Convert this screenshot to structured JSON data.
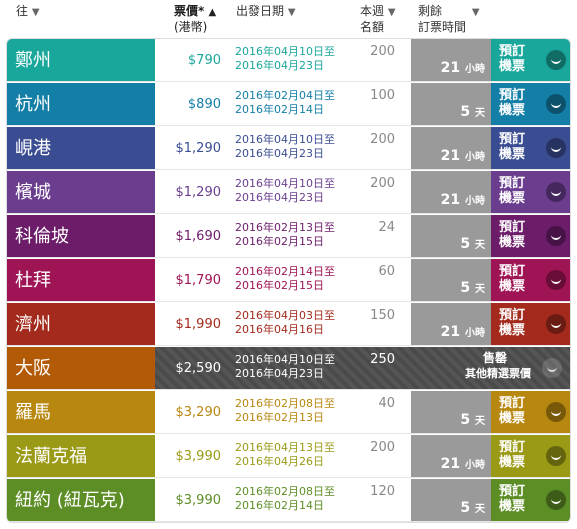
{
  "header": {
    "dest_label": "往",
    "price_label": "票價*",
    "price_sub": "(港幣)",
    "date_label": "出發日期",
    "quota_label": "本週",
    "quota_sub": "名額",
    "remaining_label": "剩餘",
    "remaining_sub": "訂票時間",
    "sort_down": "▼",
    "sort_up": "▲"
  },
  "book_label_1": "預訂",
  "book_label_2": "機票",
  "sold_label_1": "售罄",
  "sold_label_2": "其他精選票價",
  "rows": [
    {
      "dest": "鄭州",
      "price": "$790",
      "d1": "2016年04月10日至",
      "d2": "2016年04月23日",
      "quota": "200",
      "time": "21",
      "unit": "小時",
      "color": "#1aa79b",
      "datecolor": "#1aa79b"
    },
    {
      "dest": "杭州",
      "price": "$890",
      "d1": "2016年02月04日至",
      "d2": "2016年02月14日",
      "quota": "100",
      "time": "5",
      "unit": "天",
      "color": "#137ea6",
      "datecolor": "#137ea6"
    },
    {
      "dest": "峴港",
      "price": "$1,290",
      "d1": "2016年04月10日至",
      "d2": "2016年04月23日",
      "quota": "200",
      "time": "21",
      "unit": "小時",
      "color": "#3b4d92",
      "datecolor": "#3b4d92"
    },
    {
      "dest": "檳城",
      "price": "$1,290",
      "d1": "2016年04月10日至",
      "d2": "2016年04月23日",
      "quota": "200",
      "time": "21",
      "unit": "小時",
      "color": "#6b3d8f",
      "datecolor": "#6b3d8f"
    },
    {
      "dest": "科倫坡",
      "price": "$1,690",
      "d1": "2016年02月13日至",
      "d2": "2016年02月15日",
      "quota": "24",
      "time": "5",
      "unit": "天",
      "color": "#6d1c6a",
      "datecolor": "#6d1c6a"
    },
    {
      "dest": "杜拜",
      "price": "$1,790",
      "d1": "2016年02月14日至",
      "d2": "2016年02月15日",
      "quota": "60",
      "time": "5",
      "unit": "天",
      "color": "#9e1454",
      "datecolor": "#9e1454"
    },
    {
      "dest": "濟州",
      "price": "$1,990",
      "d1": "2016年04月03日至",
      "d2": "2016年04月16日",
      "quota": "150",
      "time": "21",
      "unit": "小時",
      "color": "#a32a1c",
      "datecolor": "#a32a1c"
    },
    {
      "dest": "大阪",
      "price": "$2,590",
      "d1": "2016年04月10日至",
      "d2": "2016年04月23日",
      "quota": "250",
      "time": "",
      "unit": "",
      "color": "#b25a06",
      "datecolor": "#ffffff",
      "sold": true
    },
    {
      "dest": "羅馬",
      "price": "$3,290",
      "d1": "2016年02月08日至",
      "d2": "2016年02月13日",
      "quota": "40",
      "time": "5",
      "unit": "天",
      "color": "#b8870f",
      "datecolor": "#b8870f"
    },
    {
      "dest": "法蘭克福",
      "price": "$3,990",
      "d1": "2016年04月13日至",
      "d2": "2016年04月26日",
      "quota": "200",
      "time": "21",
      "unit": "小時",
      "color": "#9a9a16",
      "datecolor": "#9a9a16"
    },
    {
      "dest": "紐約 (紐瓦克)",
      "price": "$3,990",
      "d1": "2016年02月08日至",
      "d2": "2016年02月14日",
      "quota": "120",
      "time": "5",
      "unit": "天",
      "color": "#5d8e26",
      "datecolor": "#5d8e26"
    }
  ]
}
